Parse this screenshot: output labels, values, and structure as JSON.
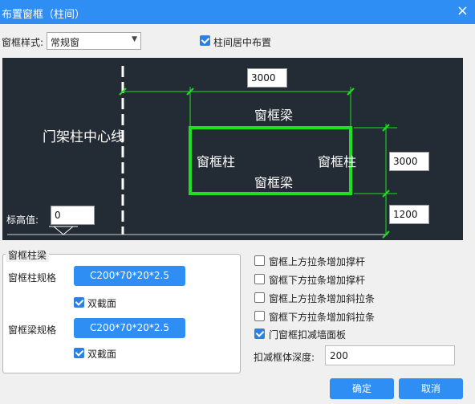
{
  "window": {
    "title": "布置窗框（柱间）",
    "close": "×"
  },
  "style_row": {
    "label": "窗框样式:",
    "value": "常规窗",
    "center_checkbox": {
      "label": "柱间居中布置",
      "checked": true
    }
  },
  "preview": {
    "centerline_label": "门架柱中心线",
    "beam_top_label": "窗框梁",
    "beam_bottom_label": "窗框梁",
    "left_column_label": "窗框柱",
    "right_column_label": "窗框柱",
    "width_value": "3000",
    "height_value": "3000",
    "bottom_value": "1200",
    "elevation_label": "标高值:",
    "elevation_value": "0",
    "frame_color": "#1fe01f"
  },
  "group": {
    "title": "窗框柱梁",
    "column_spec_label": "窗框柱规格",
    "column_spec_value": "C200*70*20*2.5",
    "column_double_label": "双截面",
    "beam_spec_label": "窗框梁规格",
    "beam_spec_value": "C200*70*20*2.5",
    "beam_double_label": "双截面"
  },
  "options": [
    {
      "label": "窗框上方拉条增加撑杆",
      "checked": false
    },
    {
      "label": "窗框下方拉条增加撑杆",
      "checked": false
    },
    {
      "label": "窗框上方拉条增加斜拉条",
      "checked": false
    },
    {
      "label": "窗框下方拉条增加斜拉条",
      "checked": false
    },
    {
      "label": "门窗框扣减墙面板",
      "checked": true
    }
  ],
  "deduct": {
    "label": "扣减框体深度:",
    "value": "200"
  },
  "buttons": {
    "ok": "确定",
    "cancel": "取消"
  },
  "colors": {
    "accent": "#2f8ef3",
    "preview_bg": "#232b34"
  }
}
